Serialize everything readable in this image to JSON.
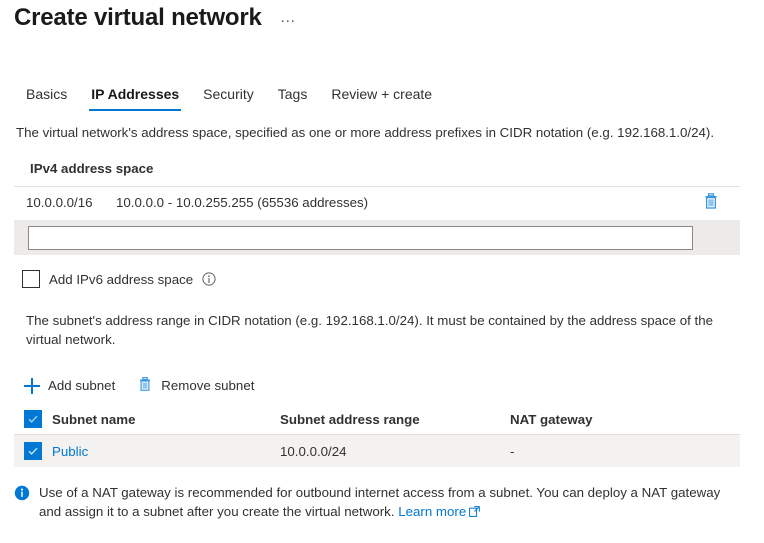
{
  "header": {
    "title": "Create virtual network",
    "more_menu": "…"
  },
  "tabs": [
    {
      "label": "Basics",
      "active": false
    },
    {
      "label": "IP Addresses",
      "active": true
    },
    {
      "label": "Security",
      "active": false
    },
    {
      "label": "Tags",
      "active": false
    },
    {
      "label": "Review + create",
      "active": false
    }
  ],
  "descriptions": {
    "address_space": "The virtual network's address space, specified as one or more address prefixes in CIDR notation (e.g. 192.168.1.0/24).",
    "subnet_range": "The subnet's address range in CIDR notation (e.g. 192.168.1.0/24). It must be contained by the address space of the virtual network."
  },
  "ipv4_section": {
    "label": "IPv4 address space",
    "rows": [
      {
        "cidr": "10.0.0.0/16",
        "range": "10.0.0.0 - 10.0.255.255 (65536 addresses)",
        "delete_icon": "trash-icon"
      }
    ],
    "new_entry": {
      "value": "",
      "placeholder": ""
    }
  },
  "ipv6_option": {
    "label": "Add IPv6 address space",
    "checked": false,
    "info_icon": "info-circle-icon"
  },
  "subnet_toolbar": [
    {
      "label": "Add subnet",
      "icon": "plus-icon"
    },
    {
      "label": "Remove subnet",
      "icon": "trash-icon"
    }
  ],
  "subnet_grid": {
    "select_all_checked": true,
    "columns": [
      "Subnet name",
      "Subnet address range",
      "NAT gateway"
    ],
    "rows": [
      {
        "selected": true,
        "name": "Public",
        "address_range": "10.0.0.0/24",
        "nat_gateway": "-"
      }
    ]
  },
  "info_banner": {
    "icon": "info-circle-icon",
    "text": "Use of a NAT gateway is recommended for outbound internet access from a subnet. You can deploy a NAT gateway and assign it to a subnet after you create the virtual network.",
    "link_label": "Learn more",
    "link_icon": "external-link-icon"
  },
  "colors": {
    "accent": "#0078d4",
    "text": "#323130",
    "band": "#edebe9",
    "row": "#f3f2f1"
  }
}
